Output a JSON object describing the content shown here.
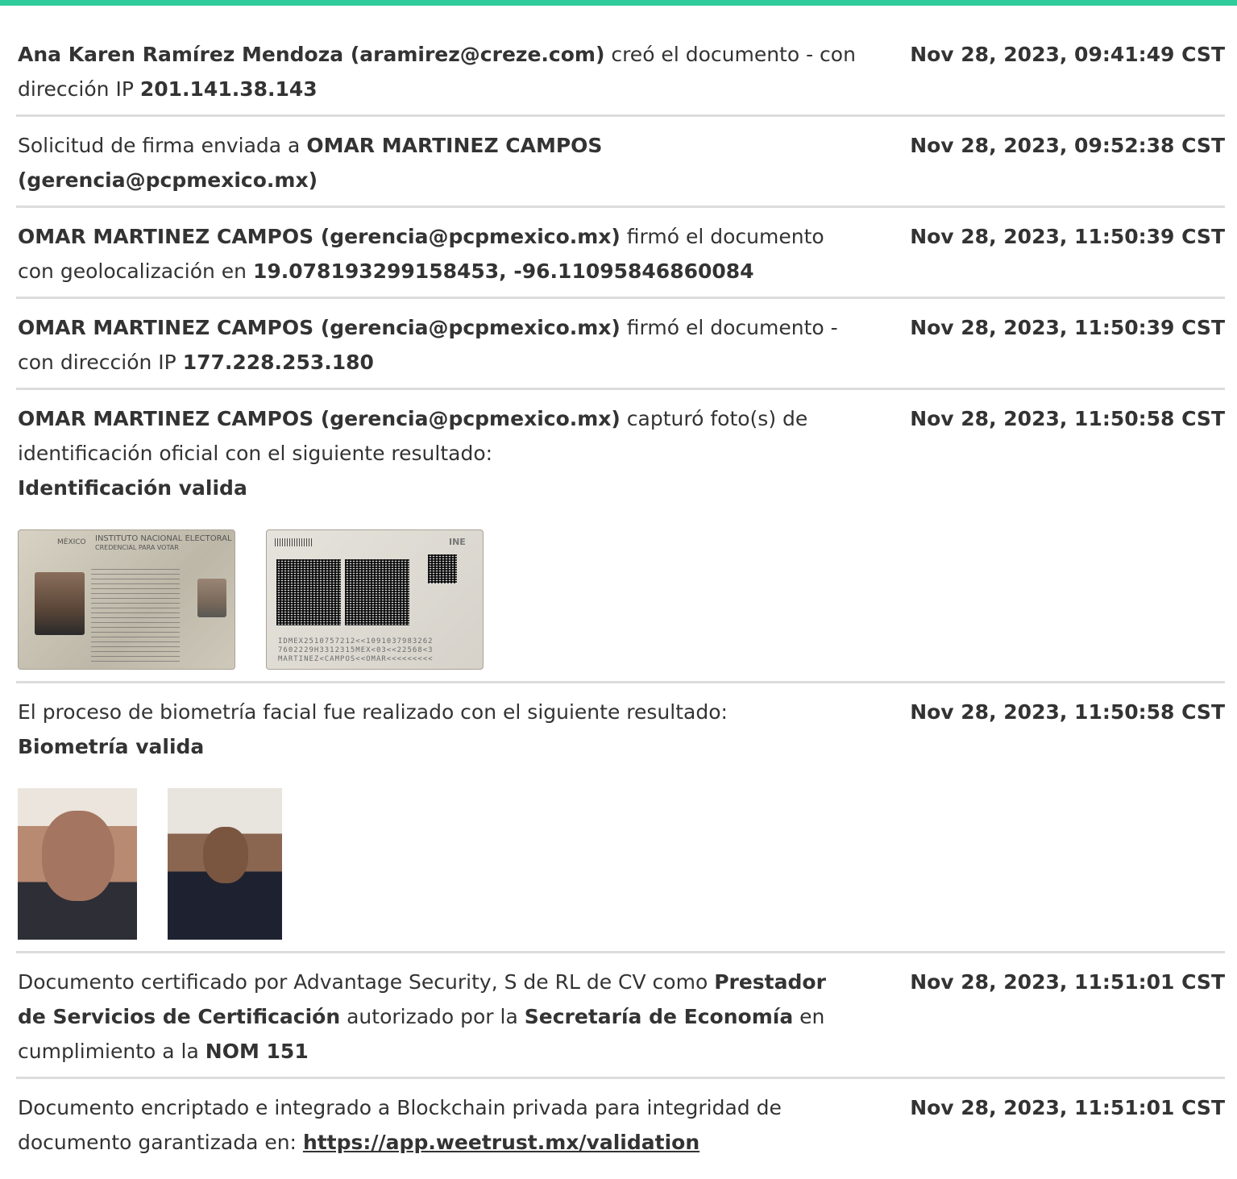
{
  "entries": [
    {
      "parts": [
        {
          "t": "Ana Karen Ramírez Mendoza (aramirez@creze.com)",
          "b": true
        },
        {
          "t": " creó el documento - con dirección IP ",
          "b": false
        },
        {
          "t": "201.141.38.143",
          "b": true
        }
      ],
      "timestamp": "Nov 28, 2023, 09:41:49 CST"
    },
    {
      "parts": [
        {
          "t": "Solicitud de firma enviada a ",
          "b": false
        },
        {
          "t": "OMAR MARTINEZ CAMPOS (gerencia@pcpmexico.mx)",
          "b": true
        }
      ],
      "timestamp": "Nov 28, 2023, 09:52:38 CST"
    },
    {
      "parts": [
        {
          "t": "OMAR MARTINEZ CAMPOS (gerencia@pcpmexico.mx)",
          "b": true
        },
        {
          "t": " firmó el documento con geolocalización en ",
          "b": false
        },
        {
          "t": "19.078193299158453, -96.11095846860084",
          "b": true
        }
      ],
      "timestamp": "Nov 28, 2023, 11:50:39 CST"
    },
    {
      "parts": [
        {
          "t": "OMAR MARTINEZ CAMPOS (gerencia@pcpmexico.mx)",
          "b": true
        },
        {
          "t": " firmó el documento - con dirección IP ",
          "b": false
        },
        {
          "t": "177.228.253.180",
          "b": true
        }
      ],
      "timestamp": "Nov 28, 2023, 11:50:39 CST"
    },
    {
      "parts": [
        {
          "t": "OMAR MARTINEZ CAMPOS (gerencia@pcpmexico.mx)",
          "b": true
        },
        {
          "t": " capturó foto(s) de identificación oficial con el siguiente resultado:",
          "b": false
        },
        {
          "t": "Identificación valida",
          "b": true,
          "br": true
        }
      ],
      "timestamp": "Nov 28, 2023, 11:50:58 CST",
      "images": "id"
    },
    {
      "parts": [
        {
          "t": "El proceso de biometría facial fue realizado con el siguiente resultado:",
          "b": false
        },
        {
          "t": "Biometría valida",
          "b": true,
          "br": true
        }
      ],
      "timestamp": "Nov 28, 2023, 11:50:58 CST",
      "images": "face"
    },
    {
      "parts": [
        {
          "t": "Documento certificado por Advantage Security, S de RL de CV como ",
          "b": false
        },
        {
          "t": "Prestador de Servicios de Certificación",
          "b": true
        },
        {
          "t": " autorizado por la ",
          "b": false
        },
        {
          "t": "Secretaría de Economía",
          "b": true
        },
        {
          "t": " en cumplimiento a la ",
          "b": false
        },
        {
          "t": "NOM 151",
          "b": true
        }
      ],
      "timestamp": "Nov 28, 2023, 11:51:01 CST"
    },
    {
      "parts": [
        {
          "t": "Documento encriptado e integrado a Blockchain privada para integridad de documento garantizada en: ",
          "b": false
        },
        {
          "t": "https://app.weetrust.mx/validation",
          "link": true
        }
      ],
      "timestamp": "Nov 28, 2023, 11:51:01 CST"
    }
  ],
  "id_card": {
    "front_country": "MÉXICO",
    "front_title": "INSTITUTO NACIONAL ELECTORAL",
    "front_subtitle": "CREDENCIAL PARA VOTAR",
    "back_logo": "INE",
    "mrz": [
      "IDMEX2510757212<<1091037983262",
      "7602229H3312315MEX<03<<22568<3",
      "MARTINEZ<CAMPOS<<OMAR<<<<<<<<<"
    ]
  },
  "colors": {
    "accent": "#2ecc9a",
    "divider": "#dcdcdc",
    "text": "#333333"
  }
}
